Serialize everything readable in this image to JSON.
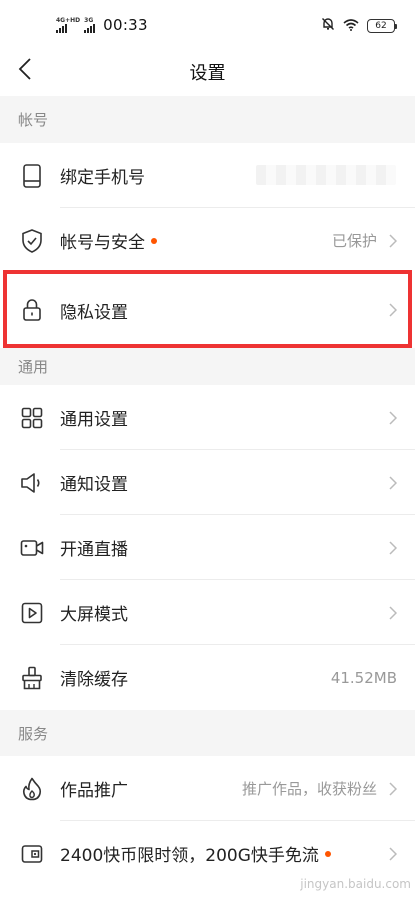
{
  "status": {
    "net1": "4G+HD",
    "net2": "3G",
    "time": "00:33",
    "battery": "62"
  },
  "nav": {
    "title": "设置"
  },
  "sections": {
    "account": "帐号",
    "general": "通用",
    "service": "服务"
  },
  "rows": {
    "bind_phone": {
      "label": "绑定手机号"
    },
    "account_security": {
      "label": "帐号与安全",
      "value": "已保护"
    },
    "privacy": {
      "label": "隐私设置"
    },
    "general_settings": {
      "label": "通用设置"
    },
    "notification": {
      "label": "通知设置"
    },
    "live": {
      "label": "开通直播"
    },
    "big_screen": {
      "label": "大屏模式"
    },
    "clear_cache": {
      "label": "清除缓存",
      "value": "41.52MB"
    },
    "promotion": {
      "label": "作品推广",
      "value": "推广作品，收获粉丝"
    },
    "coins": {
      "label": "2400快币限时领，200G快手免流"
    }
  },
  "watermark": "jingyan.baidu.com",
  "colors": {
    "accent_dot": "#ff5500",
    "highlight": "#ee3333",
    "section_bg": "#f5f5f5"
  }
}
